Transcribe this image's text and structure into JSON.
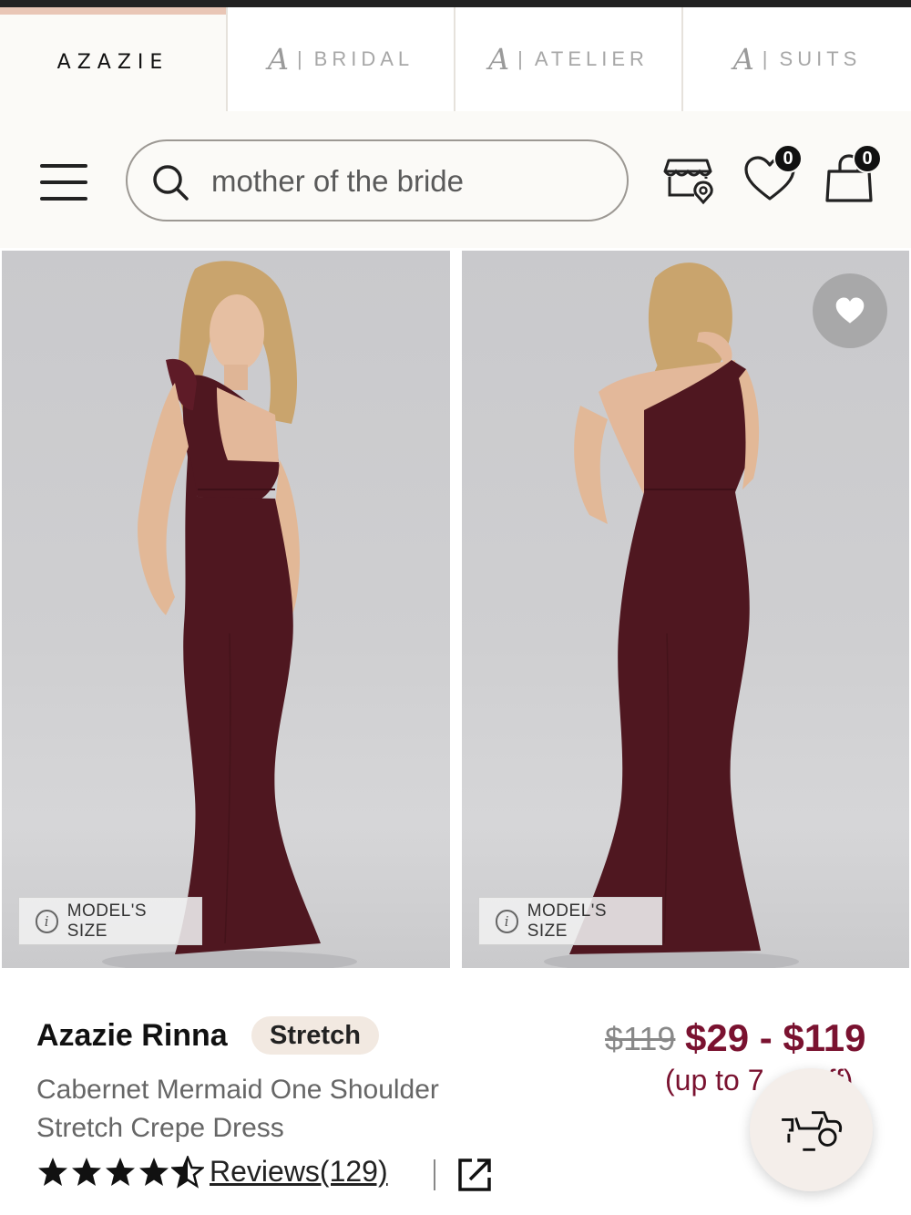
{
  "tabs": [
    {
      "label": "AZAZIE"
    },
    {
      "label": "BRIDAL"
    },
    {
      "label": "ATELIER"
    },
    {
      "label": "SUITS"
    }
  ],
  "monogram": "A",
  "search": {
    "value": "mother of the bride"
  },
  "header": {
    "wishlist_count": "0",
    "bag_count": "0"
  },
  "gallery": {
    "model_size_label": "MODEL'S SIZE"
  },
  "product": {
    "name": "Azazie Rinna",
    "tag": "Stretch",
    "description": "Cabernet Mermaid One Shoulder Stretch Crepe Dress",
    "old_price": "$119",
    "price": "$29 - $119",
    "discount": "(up to 7",
    "discount_end": "ff)",
    "rating": 4.5,
    "reviews": "Reviews(129)",
    "dress_color": "#4f1720"
  },
  "colors": {
    "accent": "#7a1230",
    "tab_highlight": "#e9c6b6"
  },
  "icons": [
    "search-icon",
    "store-location-icon",
    "heart-icon",
    "shopping-bag-icon",
    "share-icon",
    "delivery-scooter-icon"
  ]
}
